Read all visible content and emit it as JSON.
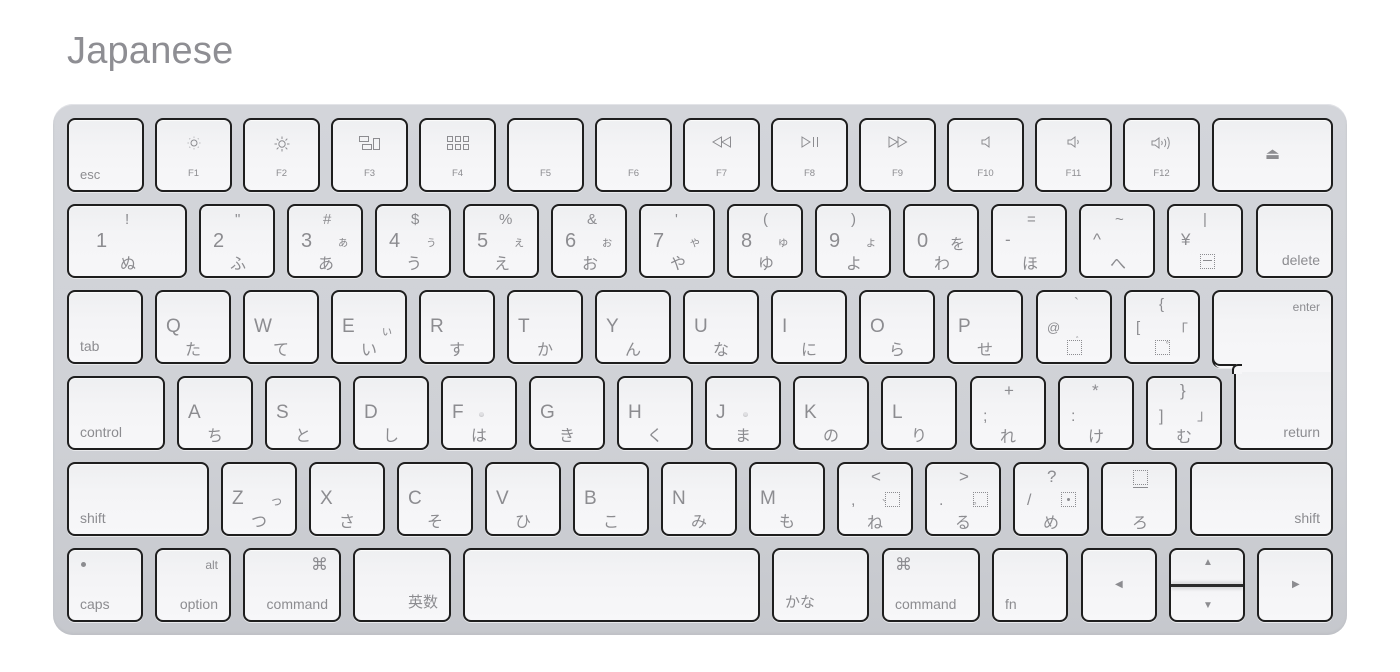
{
  "title": "Japanese",
  "fn_row": {
    "esc": "esc",
    "keys": [
      {
        "label": "F1",
        "icon": "brightness-down-icon"
      },
      {
        "label": "F2",
        "icon": "brightness-up-icon"
      },
      {
        "label": "F3",
        "icon": "mission-control-icon"
      },
      {
        "label": "F4",
        "icon": "launchpad-icon"
      },
      {
        "label": "F5",
        "icon": ""
      },
      {
        "label": "F6",
        "icon": ""
      },
      {
        "label": "F7",
        "icon": "rewind-icon"
      },
      {
        "label": "F8",
        "icon": "play-pause-icon"
      },
      {
        "label": "F9",
        "icon": "fast-forward-icon"
      },
      {
        "label": "F10",
        "icon": "mute-icon"
      },
      {
        "label": "F11",
        "icon": "volume-down-icon"
      },
      {
        "label": "F12",
        "icon": "volume-up-icon"
      }
    ],
    "eject": "⏏"
  },
  "number_row": {
    "keys": [
      {
        "main": "1",
        "shift": "!",
        "kana": "ぬ",
        "kana_small": ""
      },
      {
        "main": "2",
        "shift": "\"",
        "kana": "ふ",
        "kana_small": ""
      },
      {
        "main": "3",
        "shift": "#",
        "kana": "あ",
        "kana_small": "ぁ"
      },
      {
        "main": "4",
        "shift": "$",
        "kana": "う",
        "kana_small": "ぅ"
      },
      {
        "main": "5",
        "shift": "%",
        "kana": "え",
        "kana_small": "ぇ"
      },
      {
        "main": "6",
        "shift": "&",
        "kana": "お",
        "kana_small": "ぉ"
      },
      {
        "main": "7",
        "shift": "'",
        "kana": "や",
        "kana_small": "ゃ"
      },
      {
        "main": "8",
        "shift": "(",
        "kana": "ゆ",
        "kana_small": "ゅ"
      },
      {
        "main": "9",
        "shift": ")",
        "kana": "よ",
        "kana_small": "ょ"
      },
      {
        "main": "0",
        "shift": "",
        "kana": "わ",
        "kana_small": "を"
      },
      {
        "main": "-",
        "shift": "=",
        "kana": "ほ",
        "kana_small": ""
      },
      {
        "main": "^",
        "shift": "~",
        "kana": "へ",
        "kana_small": ""
      },
      {
        "main": "¥",
        "shift": "|",
        "kana": "",
        "kana_small": ""
      }
    ],
    "delete": "delete"
  },
  "top_row": {
    "tab": "tab",
    "keys": [
      {
        "main": "Q",
        "kana": "た",
        "kana_small": ""
      },
      {
        "main": "W",
        "kana": "て",
        "kana_small": ""
      },
      {
        "main": "E",
        "kana": "い",
        "kana_small": "ぃ"
      },
      {
        "main": "R",
        "kana": "す",
        "kana_small": ""
      },
      {
        "main": "T",
        "kana": "か",
        "kana_small": ""
      },
      {
        "main": "Y",
        "kana": "ん",
        "kana_small": ""
      },
      {
        "main": "U",
        "kana": "な",
        "kana_small": ""
      },
      {
        "main": "I",
        "kana": "に",
        "kana_small": ""
      },
      {
        "main": "O",
        "kana": "ら",
        "kana_small": ""
      },
      {
        "main": "P",
        "kana": "せ",
        "kana_small": ""
      },
      {
        "main": "@",
        "shift": "`",
        "kana": "",
        "kana_small": ""
      },
      {
        "main": "[",
        "shift": "{",
        "kana": "",
        "kana_small": "「"
      }
    ],
    "enter": "enter",
    "return": "return"
  },
  "home_row": {
    "control": "control",
    "keys": [
      {
        "main": "A",
        "kana": "ち"
      },
      {
        "main": "S",
        "kana": "と"
      },
      {
        "main": "D",
        "kana": "し"
      },
      {
        "main": "F",
        "kana": "は",
        "bump": true
      },
      {
        "main": "G",
        "kana": "き"
      },
      {
        "main": "H",
        "kana": "く"
      },
      {
        "main": "J",
        "kana": "ま",
        "bump": true
      },
      {
        "main": "K",
        "kana": "の"
      },
      {
        "main": "L",
        "kana": "り"
      },
      {
        "main": ";",
        "shift": "+",
        "kana": "れ"
      },
      {
        "main": ":",
        "shift": "*",
        "kana": "け"
      },
      {
        "main": "]",
        "shift": "}",
        "kana": "む",
        "kana_small": "」"
      }
    ]
  },
  "bottom_row": {
    "shift_left": "shift",
    "keys": [
      {
        "main": "Z",
        "kana": "つ",
        "kana_small": "っ"
      },
      {
        "main": "X",
        "kana": "さ"
      },
      {
        "main": "C",
        "kana": "そ"
      },
      {
        "main": "V",
        "kana": "ひ"
      },
      {
        "main": "B",
        "kana": "こ"
      },
      {
        "main": "N",
        "kana": "み"
      },
      {
        "main": "M",
        "kana": "も"
      },
      {
        "main": ",",
        "shift": "<",
        "kana": "ね"
      },
      {
        "main": ".",
        "shift": ">",
        "kana": "る"
      },
      {
        "main": "/",
        "shift": "?",
        "kana": "め"
      },
      {
        "main": "",
        "shift": "",
        "kana": "ろ"
      }
    ],
    "shift_right": "shift"
  },
  "modifier_row": {
    "caps": "caps",
    "option": "option",
    "alt": "alt",
    "command_left": "command",
    "command_symbol": "⌘",
    "eisu": "英数",
    "kana": "かな",
    "command_right": "command",
    "fn": "fn",
    "arrow_left": "◀",
    "arrow_up": "▲",
    "arrow_down": "▼",
    "arrow_right": "▶"
  }
}
